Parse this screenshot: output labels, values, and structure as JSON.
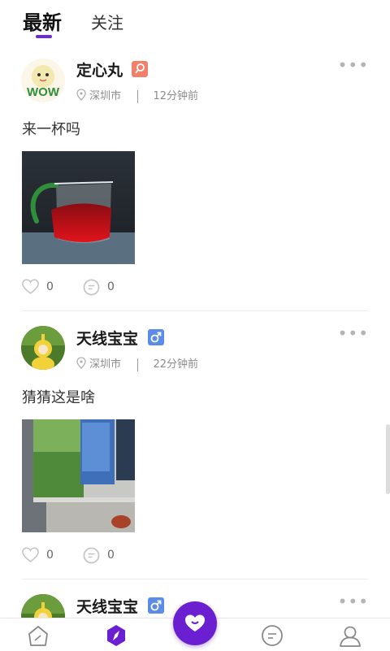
{
  "tabs": {
    "latest": "最新",
    "follow": "关注"
  },
  "posts": [
    {
      "username": "定心丸",
      "gender": "female",
      "badge_icon": "search-tag-icon",
      "location": "深圳市",
      "time": "12分钟前",
      "content": "来一杯吗",
      "likes": "0",
      "comments": "0",
      "more": "•••"
    },
    {
      "username": "天线宝宝",
      "gender": "male",
      "badge_icon": "male-symbol-icon",
      "location": "深圳市",
      "time": "22分钟前",
      "content": "猜猜这是啥",
      "likes": "0",
      "comments": "0",
      "more": "•••"
    },
    {
      "username": "天线宝宝",
      "gender": "male",
      "badge_icon": "male-symbol-icon",
      "more": "•••"
    }
  ],
  "nav": {
    "items": [
      {
        "name": "home",
        "icon": "home-icon"
      },
      {
        "name": "discover",
        "icon": "compass-icon",
        "active": true
      },
      {
        "name": "match",
        "icon": "heart-chat-icon"
      },
      {
        "name": "messages",
        "icon": "chat-icon"
      },
      {
        "name": "profile",
        "icon": "profile-icon"
      }
    ]
  },
  "colors": {
    "accent": "#6a1fd1",
    "female_badge": "#f0806a",
    "male_badge": "#5a8ce8"
  }
}
